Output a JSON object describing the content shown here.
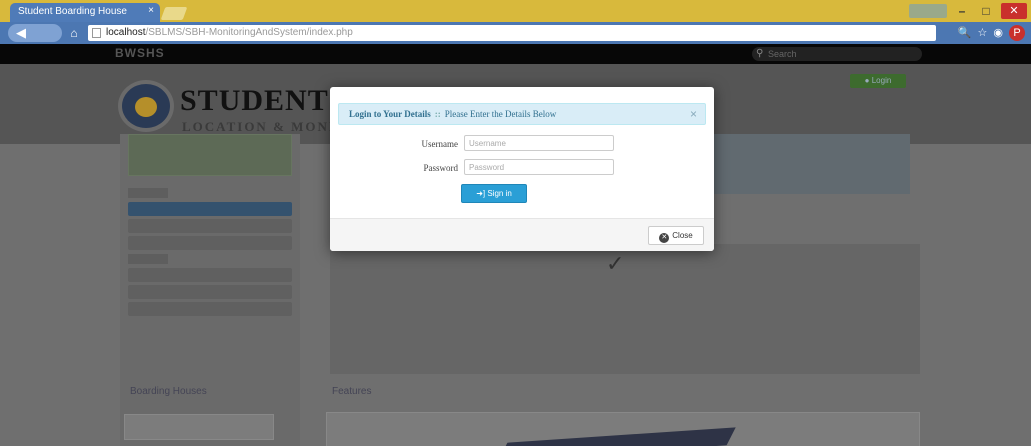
{
  "browser": {
    "tab_title": "Student Boarding House",
    "tab_close": "×",
    "back_icon": "◀",
    "home_icon": "⌂",
    "url_host": "localhost",
    "url_path": "/SBLMS/SBH-MonitoringAndSystem/index.php",
    "window_minimize": "–",
    "window_maximize": "□",
    "window_close": "✕"
  },
  "page": {
    "navbar_brand": "BWSHS",
    "search_placeholder": "Search",
    "logo_title": "STUDENT'S BOARDING HOUSE",
    "logo_subtitle": "LOCATION & MONITORING",
    "header_button": "● Login",
    "section_left": "Boarding Houses",
    "section_right": "Features"
  },
  "modal": {
    "title": "Login to Your Details",
    "separator": "::",
    "subtitle": "Please Enter the Details Below",
    "close_x": "×",
    "username_label": "Username",
    "username_placeholder": "Username",
    "password_label": "Password",
    "password_placeholder": "Password",
    "signin_label": "➜] Sign in",
    "close_label": "Close"
  },
  "colors": {
    "modal_header_bg": "#d9edf7",
    "primary_button": "#2a9fd6",
    "browser_tab_strip": "#d8b93c",
    "browser_toolbar": "#4c77b2"
  }
}
